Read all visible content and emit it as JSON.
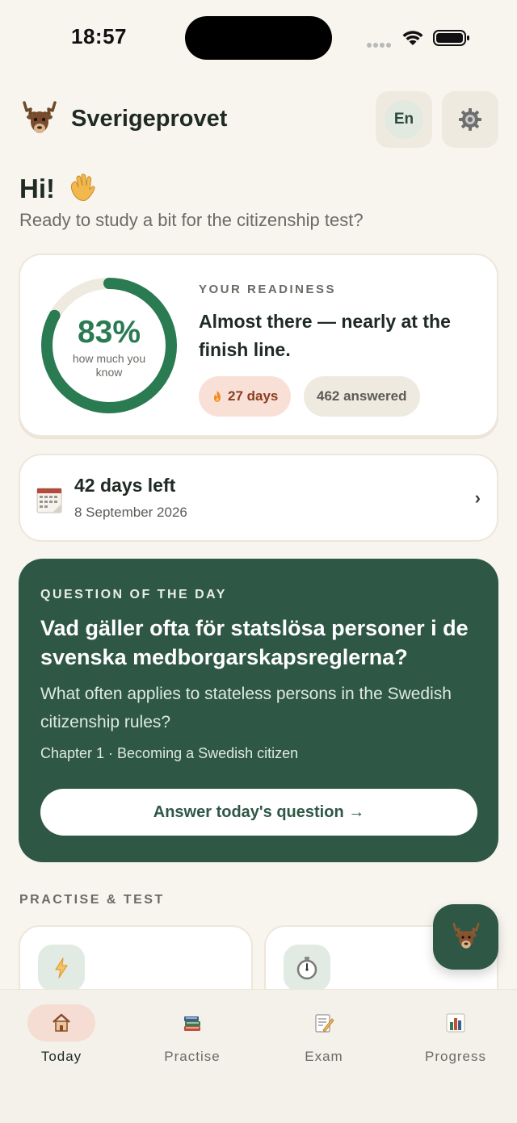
{
  "status_bar": {
    "time": "18:57"
  },
  "header": {
    "app_title": "Sverigeprovet",
    "language_button": "En",
    "logo_icon": "moose-icon",
    "settings_icon": "gear-icon"
  },
  "greeting": {
    "title": "Hi!",
    "wave_icon": "waving-hand-icon",
    "subtitle": "Ready to study a bit for the citizenship test?"
  },
  "readiness": {
    "label": "YOUR READINESS",
    "percent": 83,
    "percent_text": "83%",
    "caption": "how much you know",
    "message": "Almost there — nearly at the finish line.",
    "streak": "27 days",
    "answered": "462 answered",
    "ring_color": "#2a7a52"
  },
  "countdown": {
    "title": "42 days left",
    "date": "8 September 2026",
    "chevron": "›",
    "icon": "calendar-icon"
  },
  "question_of_day": {
    "label": "QUESTION OF THE DAY",
    "question_sv": "Vad gäller ofta för statslösa personer i de svenska medborgarskapsreglerna?",
    "question_en": "What often applies to stateless persons in the Swedish citizenship rules?",
    "chapter": "Chapter 1 · Becoming a Swedish citizen",
    "button": "Answer today's question →",
    "bg_color": "#2e5746"
  },
  "practise": {
    "label": "PRACTISE & TEST",
    "cards": [
      {
        "icon": "lightning-icon"
      },
      {
        "icon": "stopwatch-icon"
      }
    ]
  },
  "tabs": [
    {
      "label": "Today",
      "icon": "house-icon",
      "active": true
    },
    {
      "label": "Practise",
      "icon": "books-icon",
      "active": false
    },
    {
      "label": "Exam",
      "icon": "memo-icon",
      "active": false
    },
    {
      "label": "Progress",
      "icon": "bar-chart-icon",
      "active": false
    }
  ]
}
